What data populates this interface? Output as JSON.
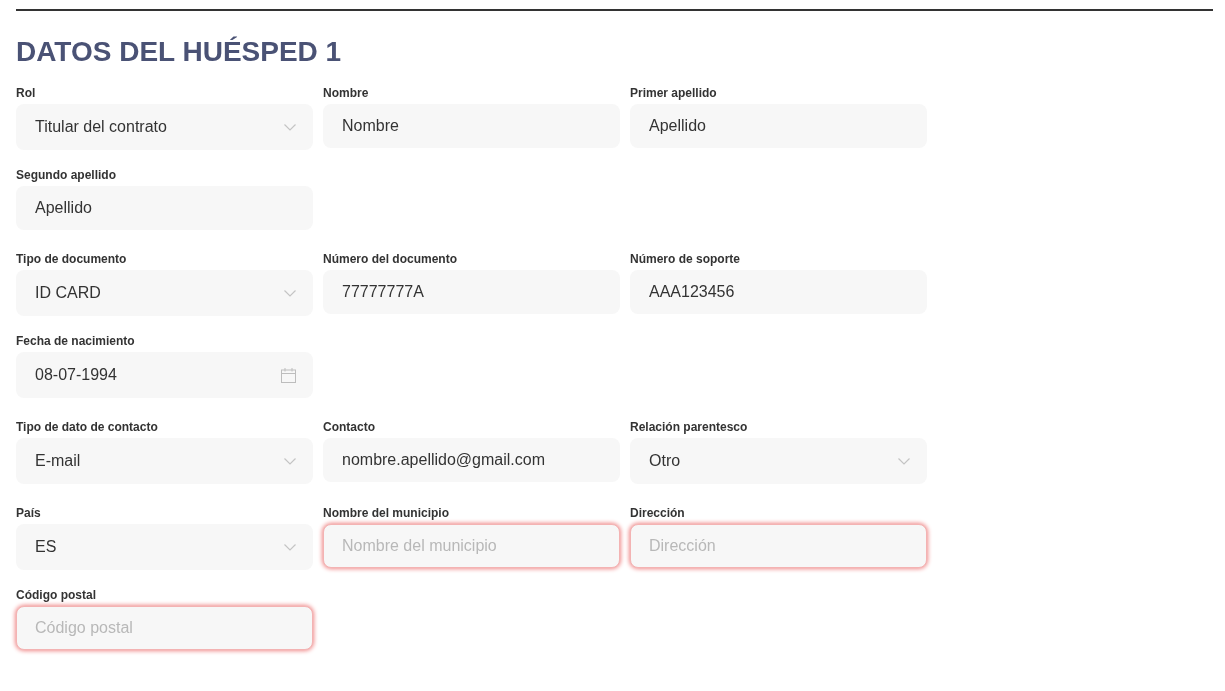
{
  "title": "DATOS DEL HUÉSPED 1",
  "groups": [
    {
      "rows": [
        [
          {
            "label": "Rol",
            "kind": "select",
            "value": "Titular del contrato",
            "invalid": false
          },
          {
            "label": "Nombre",
            "kind": "text",
            "value": "Nombre",
            "invalid": false
          },
          {
            "label": "Primer apellido",
            "kind": "text",
            "value": "Apellido",
            "invalid": false
          }
        ],
        [
          {
            "label": "Segundo apellido",
            "kind": "text",
            "value": "Apellido",
            "invalid": false
          }
        ]
      ]
    },
    {
      "rows": [
        [
          {
            "label": "Tipo de documento",
            "kind": "select",
            "value": "ID CARD",
            "invalid": false
          },
          {
            "label": "Número del documento",
            "kind": "text",
            "value": "77777777A",
            "invalid": false
          },
          {
            "label": "Número de soporte",
            "kind": "text",
            "value": "AAA123456",
            "invalid": false
          }
        ],
        [
          {
            "label": "Fecha de nacimiento",
            "kind": "date",
            "value": "08-07-1994",
            "invalid": false
          }
        ]
      ]
    },
    {
      "rows": [
        [
          {
            "label": "Tipo de dato de contacto",
            "kind": "select",
            "value": "E-mail",
            "invalid": false
          },
          {
            "label": "Contacto",
            "kind": "text",
            "value": "nombre.apellido@gmail.com",
            "invalid": false
          },
          {
            "label": "Relación parentesco",
            "kind": "select",
            "value": "Otro",
            "invalid": false
          }
        ]
      ]
    },
    {
      "rows": [
        [
          {
            "label": "País",
            "kind": "select",
            "value": "ES",
            "invalid": false
          },
          {
            "label": "Nombre del municipio",
            "kind": "text",
            "placeholder": "Nombre del municipio",
            "invalid": true
          },
          {
            "label": "Dirección",
            "kind": "text",
            "placeholder": "Dirección",
            "invalid": true
          }
        ],
        [
          {
            "label": "Código postal",
            "kind": "text",
            "placeholder": "Código postal",
            "invalid": true
          }
        ]
      ]
    }
  ]
}
